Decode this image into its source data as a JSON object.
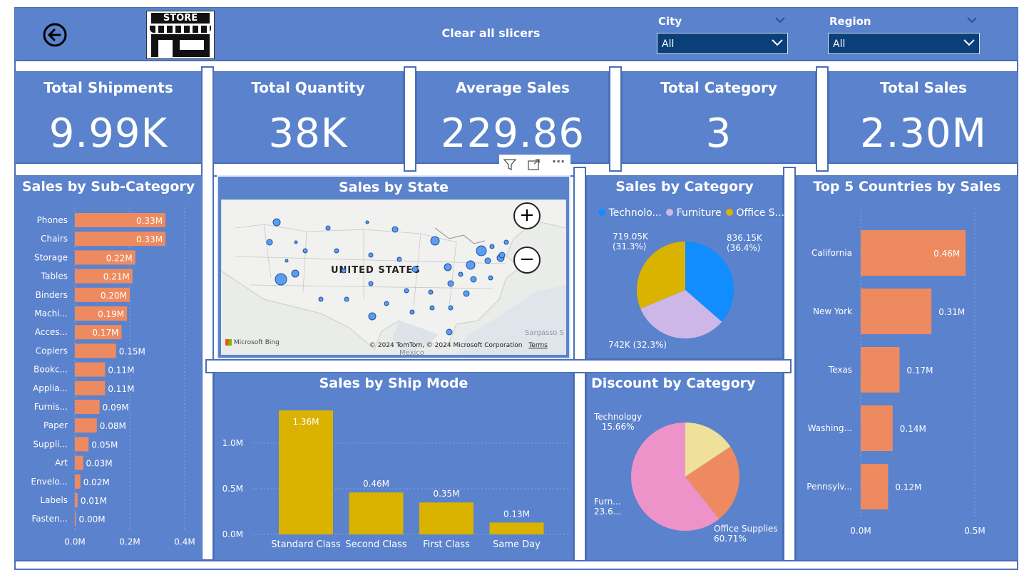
{
  "header": {
    "logo_text": "STORE",
    "clear_label": "Clear all slicers",
    "slicers": [
      {
        "label": "City",
        "value": "All"
      },
      {
        "label": "Region",
        "value": "All"
      }
    ]
  },
  "kpis": [
    {
      "title": "Total Shipments",
      "value": "9.99K"
    },
    {
      "title": "Total Quantity",
      "value": "38K"
    },
    {
      "title": "Average Sales",
      "value": "229.86"
    },
    {
      "title": "Total Category",
      "value": "3"
    },
    {
      "title": "Total Sales",
      "value": "2.30M"
    }
  ],
  "subcategory": {
    "title": "Sales by Sub-Category",
    "x_ticks": [
      "0.0M",
      "0.2M",
      "0.4M"
    ]
  },
  "state_map": {
    "title": "Sales by State",
    "country_label": "UNITED STATES",
    "sea_label": "Sargasso S",
    "mexico_label": "Mexico",
    "attribution": "© 2024 TomTom, © 2024 Microsoft Corporation",
    "terms": "Terms",
    "bing": "Microsoft Bing"
  },
  "category": {
    "title": "Sales by Category",
    "legend": [
      "Technolo...",
      "Furniture",
      "Office S..."
    ],
    "labels": [
      {
        "line1": "836.15K",
        "line2": "(36.4%)"
      },
      {
        "line1": "742K (32.3%)",
        "line2": ""
      },
      {
        "line1": "719.05K",
        "line2": "(31.3%)"
      }
    ]
  },
  "top5": {
    "title": "Top 5 Countries by Sales",
    "x_ticks": [
      "0.0M",
      "0.5M"
    ]
  },
  "shipmode": {
    "title": "Sales by Ship Mode",
    "y_ticks": [
      "1.0M",
      "0.5M",
      "0.0M"
    ]
  },
  "discount": {
    "title": "Discount by Category",
    "labels": [
      {
        "line1": "Technology",
        "line2": "15.66%"
      },
      {
        "line1": "Furn...",
        "line2": "23.6..."
      },
      {
        "line1": "Office Supplies",
        "line2": "60.71%"
      }
    ]
  },
  "chart_data": [
    {
      "type": "bar",
      "orientation": "horizontal",
      "title": "Sales by Sub-Category",
      "categories": [
        "Phones",
        "Chairs",
        "Storage",
        "Tables",
        "Binders",
        "Machi...",
        "Acces...",
        "Copiers",
        "Bookc...",
        "Applia...",
        "Furnis...",
        "Paper",
        "Suppli...",
        "Art",
        "Envelo...",
        "Labels",
        "Fasten..."
      ],
      "values": [
        0.33,
        0.33,
        0.22,
        0.21,
        0.2,
        0.19,
        0.17,
        0.15,
        0.11,
        0.11,
        0.09,
        0.08,
        0.05,
        0.03,
        0.02,
        0.01,
        0.0
      ],
      "data_labels": [
        "0.33M",
        "0.33M",
        "0.22M",
        "0.21M",
        "0.20M",
        "0.19M",
        "0.17M",
        "0.15M",
        "0.11M",
        "0.11M",
        "0.09M",
        "0.08M",
        "0.05M",
        "0.03M",
        "0.02M",
        "0.01M",
        "0.00M"
      ],
      "xlim": [
        0,
        0.4
      ],
      "color": "#ee8a5f"
    },
    {
      "type": "pie",
      "title": "Sales by Category",
      "categories": [
        "Technology",
        "Furniture",
        "Office Supplies"
      ],
      "values": [
        836.15,
        742,
        719.05
      ],
      "colors": [
        "#118dff",
        "#cdb7e8",
        "#d9b300"
      ],
      "legend": "top"
    },
    {
      "type": "bar",
      "orientation": "horizontal",
      "title": "Top 5 Countries by Sales",
      "categories": [
        "California",
        "New York",
        "Texas",
        "Washing...",
        "Pennsylv..."
      ],
      "values": [
        0.46,
        0.31,
        0.17,
        0.14,
        0.12
      ],
      "data_labels": [
        "0.46M",
        "0.31M",
        "0.17M",
        "0.14M",
        "0.12M"
      ],
      "xlim": [
        0,
        0.5
      ],
      "color": "#ee8a5f"
    },
    {
      "type": "bar",
      "title": "Sales by Ship Mode",
      "categories": [
        "Standard Class",
        "Second Class",
        "First Class",
        "Same Day"
      ],
      "values": [
        1.36,
        0.46,
        0.35,
        0.13
      ],
      "data_labels": [
        "1.36M",
        "0.46M",
        "0.35M",
        "0.13M"
      ],
      "ylim": [
        0,
        1.36
      ],
      "color": "#d9b300"
    },
    {
      "type": "pie",
      "title": "Discount by Category",
      "categories": [
        "Technology",
        "Furniture",
        "Office Supplies"
      ],
      "values": [
        15.66,
        23.63,
        60.71
      ],
      "colors": [
        "#efe09a",
        "#ee8a5f",
        "#ee93c9"
      ]
    }
  ]
}
